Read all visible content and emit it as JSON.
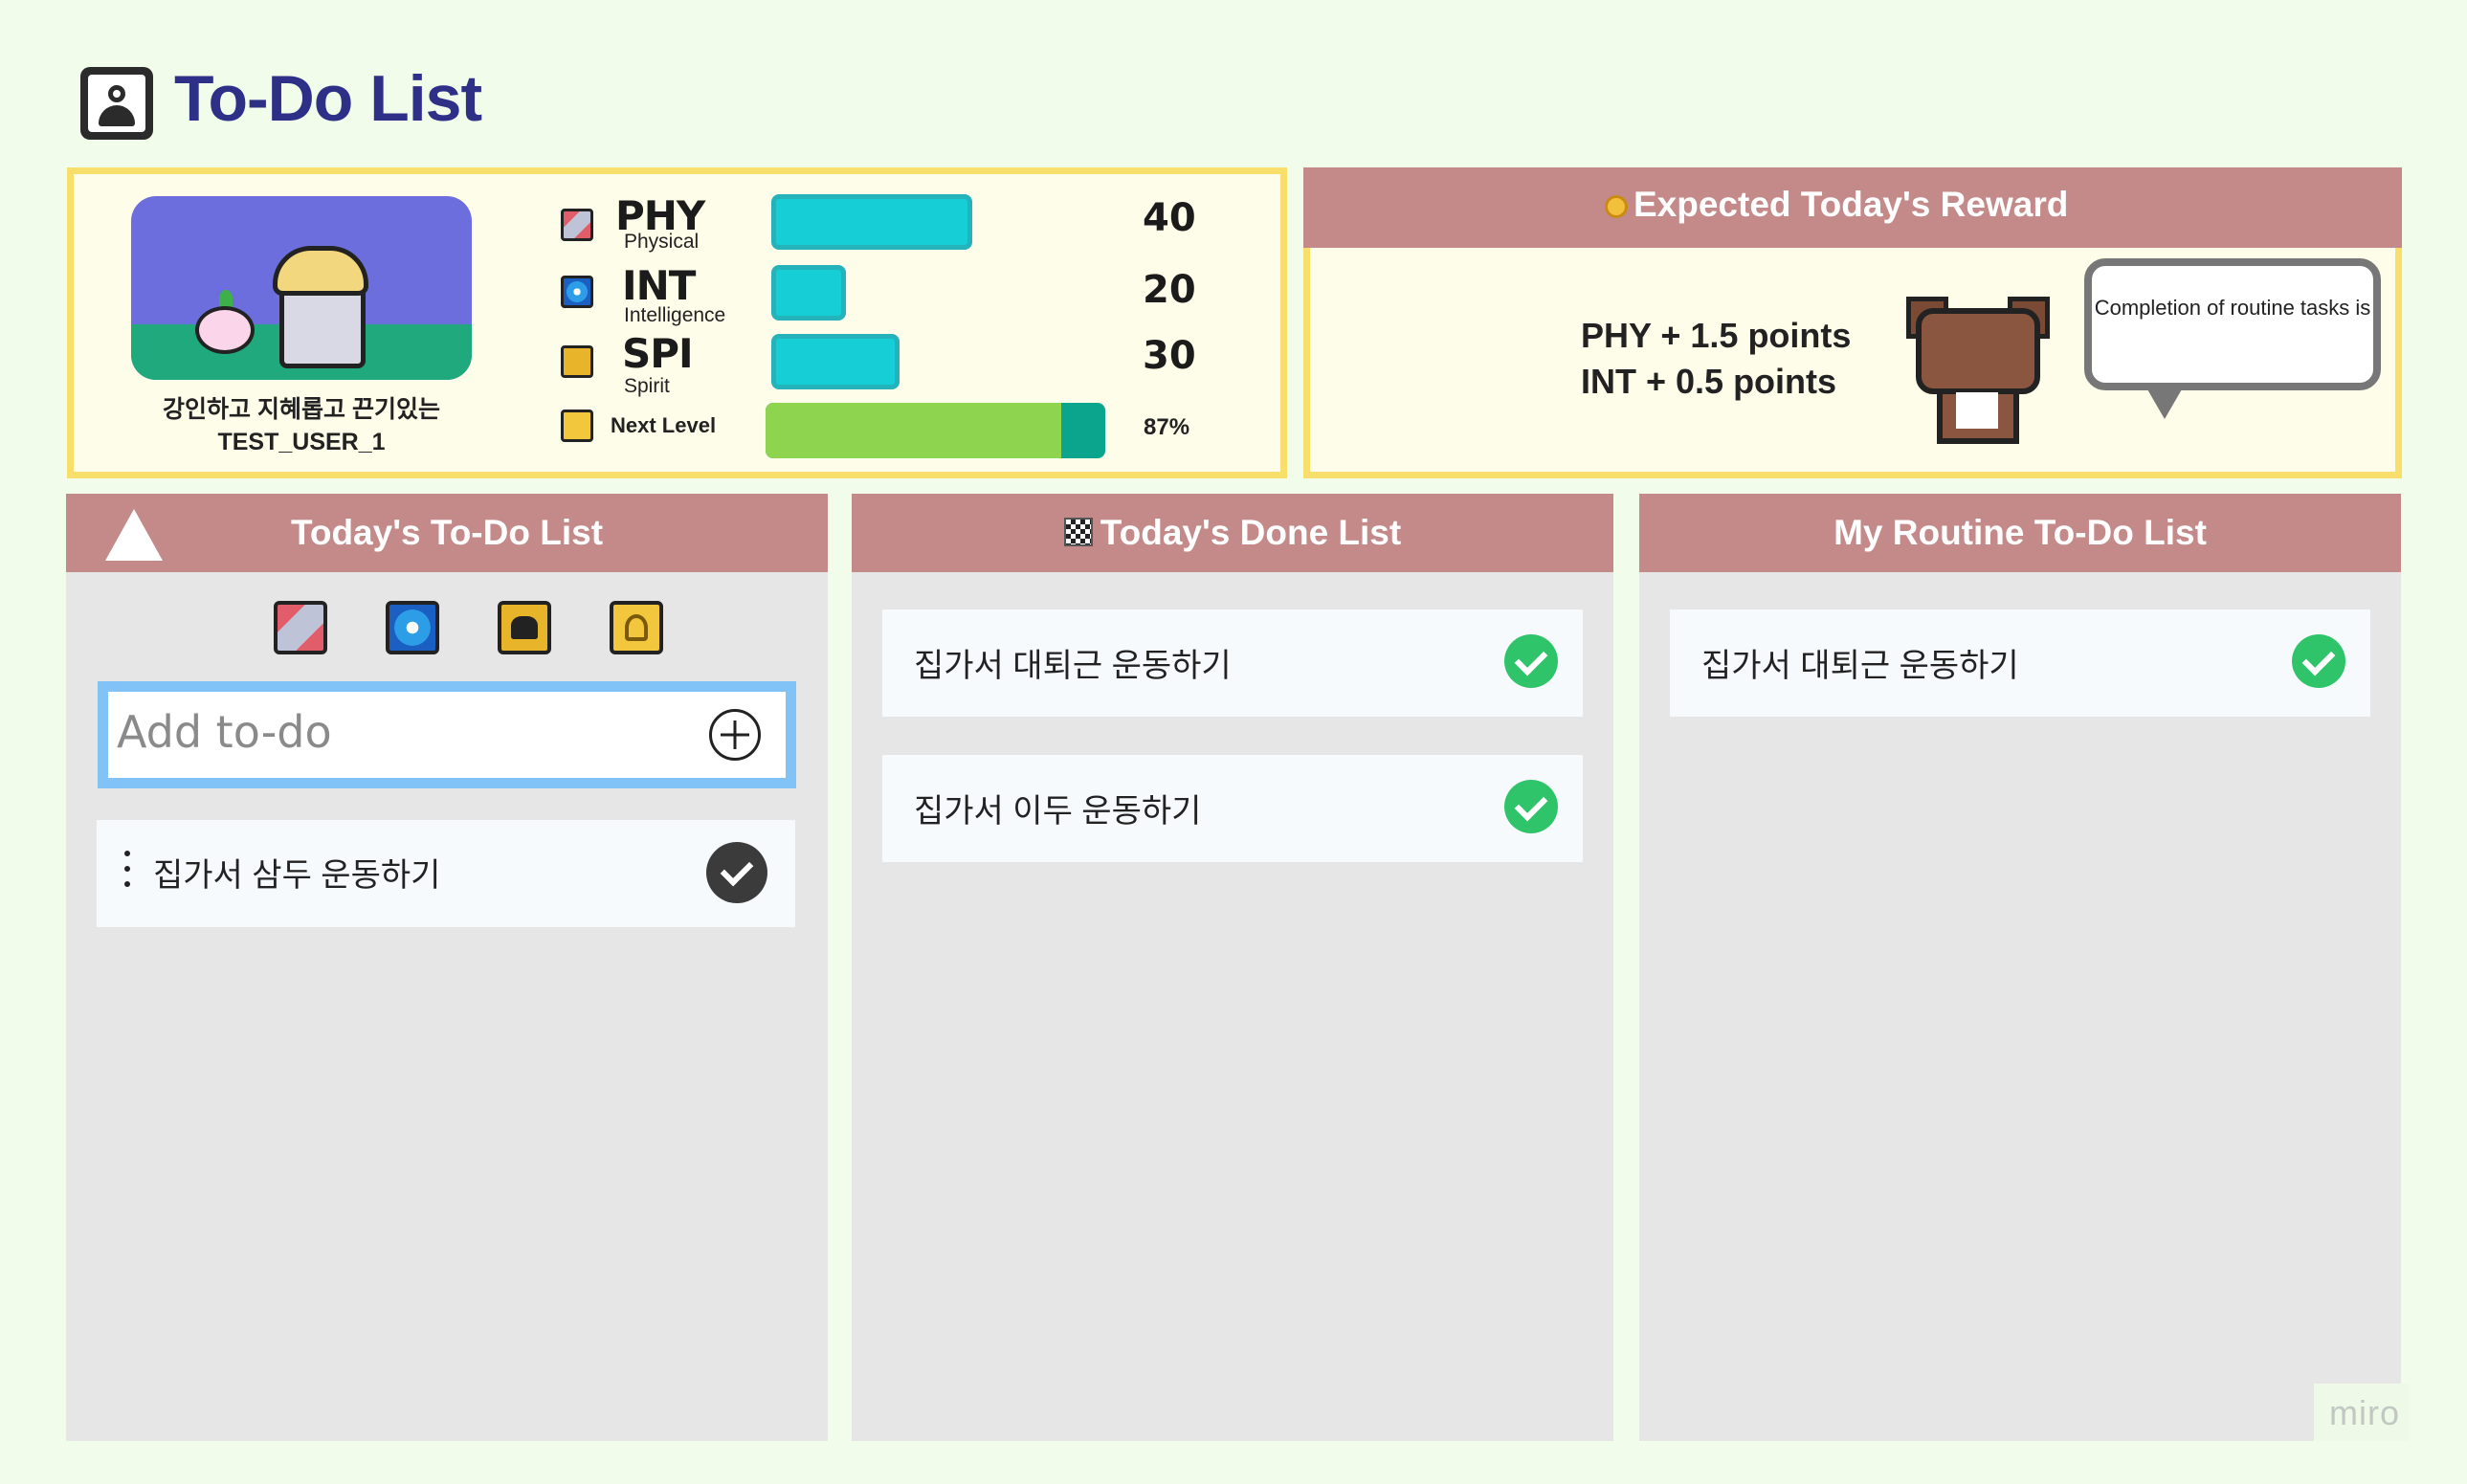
{
  "page": {
    "title": "To-Do List",
    "logo_icon": "user-badge-icon"
  },
  "status": {
    "user_title": "강인하고 지혜롭고 끈기있는",
    "user_name": "TEST_USER_1",
    "stats": [
      {
        "key": "PHY",
        "sub": "Physical",
        "value": "40",
        "icon": "sword-icon"
      },
      {
        "key": "INT",
        "sub": "Intelligence",
        "value": "20",
        "icon": "orb-icon"
      },
      {
        "key": "SPI",
        "sub": "Spirit",
        "value": "30",
        "icon": "spirit-icon"
      }
    ],
    "next_level_label": "Next Level",
    "next_level_pct": "87%",
    "next_level_value": 0.87
  },
  "reward": {
    "header": "Expected Today's Reward",
    "header_icon": "medal-icon",
    "line1": "PHY + 1.5 points",
    "line2": "INT + 0.5 points",
    "bubble": "Completion of routine tasks is"
  },
  "todo": {
    "header": "Today's To-Do List",
    "add_placeholder": "Add to-do",
    "categories": [
      "sword-icon",
      "orb-icon",
      "spirit-icon",
      "level-icon"
    ],
    "items": [
      {
        "text": "집가서 삼두 운동하기"
      }
    ]
  },
  "done": {
    "header": "Today's Done List",
    "header_icon": "checkered-flag-icon",
    "items": [
      {
        "text": "집가서 대퇴근 운동하기"
      },
      {
        "text": "집가서 이두 운동하기"
      }
    ]
  },
  "routine": {
    "header": "My Routine To-Do List",
    "items": [
      {
        "text": "집가서 대퇴근 운동하기"
      }
    ]
  },
  "watermark": "miro",
  "colors": {
    "background": "#f1fdea",
    "title": "#2e2f87",
    "panel_border": "#f8df6b",
    "column_header": "#c48a8a",
    "stat_bar": "#16cfd6",
    "level_fill": "#8fd44f",
    "level_track": "#0aa58c",
    "add_border": "#81c3f6",
    "check_green": "#2fc46a"
  }
}
